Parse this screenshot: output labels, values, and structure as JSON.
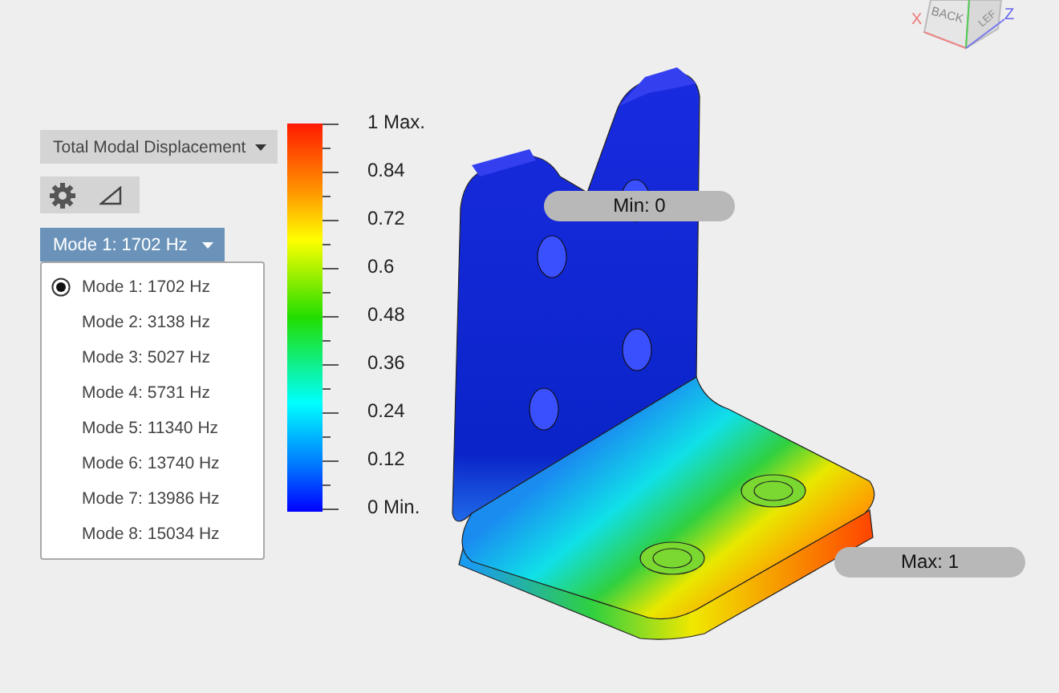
{
  "result_dropdown": {
    "label": "Total Modal Displacement"
  },
  "mode_select": {
    "label": "Mode 1: 1702 Hz"
  },
  "mode_list": [
    {
      "label": "Mode 1: 1702 Hz",
      "selected": true
    },
    {
      "label": "Mode 2: 3138 Hz",
      "selected": false
    },
    {
      "label": "Mode 3: 5027 Hz",
      "selected": false
    },
    {
      "label": "Mode 4: 5731 Hz",
      "selected": false
    },
    {
      "label": "Mode 5: 11340 Hz",
      "selected": false
    },
    {
      "label": "Mode 6: 13740 Hz",
      "selected": false
    },
    {
      "label": "Mode 7: 13986 Hz",
      "selected": false
    },
    {
      "label": "Mode 8: 15034 Hz",
      "selected": false
    }
  ],
  "legend": {
    "labels": [
      "1 Max.",
      "0.84",
      "0.72",
      "0.6",
      "0.48",
      "0.36",
      "0.24",
      "0.12",
      "0 Min."
    ]
  },
  "probes": [
    {
      "label": "Min: 0"
    },
    {
      "label": "Max: 1"
    }
  ],
  "view_cube": {
    "faces": [
      "BACK",
      "LEF"
    ],
    "axes": [
      "X",
      "Z"
    ]
  }
}
